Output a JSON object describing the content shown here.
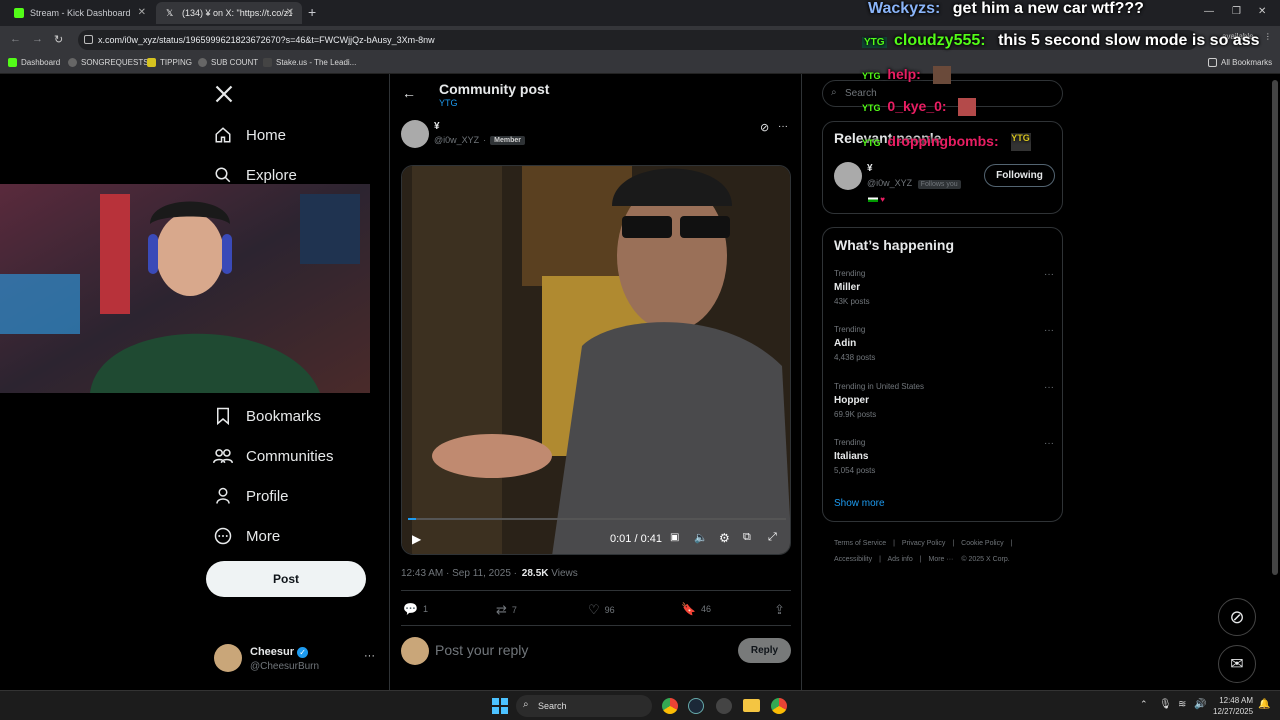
{
  "browser": {
    "tabs": [
      {
        "label": "Stream - Kick Dashboard",
        "favicon_color": "#53fc18"
      },
      {
        "label": "(134) ¥ on X: \"https://t.co/z1Ori",
        "favicon_color": "#ffffff"
      }
    ],
    "url": "x.com/i0w_xyz/status/1965999621823672670?s=46&t=FWCWjjQz-bAusy_3Xm-8nw",
    "bookmarks": [
      "Dashboard",
      "SONGREQUESTS",
      "TIPPING",
      "SUB COUNT",
      "Stake.us - The Leadi..."
    ],
    "all_bookmarks": "All Bookmarks",
    "update_badge": "available"
  },
  "nav": {
    "home": "Home",
    "explore": "Explore",
    "bookmarks": "Bookmarks",
    "communities": "Communities",
    "profile": "Profile",
    "more": "More",
    "post": "Post"
  },
  "account": {
    "name": "Cheesur",
    "handle": "@CheesurBurn",
    "more": "···"
  },
  "post_header": {
    "title": "Community post",
    "community": "YTG"
  },
  "post": {
    "author_name": "¥",
    "author_handle": "@i0w_XYZ",
    "separator": "·",
    "badge": "Member",
    "more": "···",
    "video_time": "0:01 / 0:41",
    "video_progress": 0.02,
    "timestamp": "12:43 AM · Sep 11, 2025 ·",
    "views_count": "28.5K",
    "views_label": "Views",
    "replies": "1",
    "reposts": "7",
    "likes": "96",
    "bookmarks": "46",
    "reply_placeholder": "Post your reply",
    "reply_button": "Reply"
  },
  "right": {
    "search_placeholder": "Search",
    "relevant_title": "Relevant people",
    "relevant_name": "¥",
    "relevant_handle": "@i0w_XYZ",
    "follows_you": "Follows you",
    "following_button": "Following",
    "happening_title": "What’s happening",
    "trends": [
      {
        "meta": "Trending",
        "name": "Miller",
        "count": "43K posts"
      },
      {
        "meta": "Trending",
        "name": "Adin",
        "count": "4,438 posts"
      },
      {
        "meta": "Trending in United States",
        "name": "Hopper",
        "count": "69.9K posts"
      },
      {
        "meta": "Trending",
        "name": "Italians",
        "count": "5,054 posts"
      }
    ],
    "show_more": "Show more",
    "footer": [
      "Terms of Service",
      "|",
      "Privacy Policy",
      "|",
      "Cookie Policy",
      "|",
      "Accessibility",
      "|",
      "Ads info",
      "|",
      "More ···",
      "© 2025 X Corp."
    ]
  },
  "chat": [
    {
      "nick": "Wackyzs:",
      "msg": "get him a new car wtf???",
      "color": "#8ab4f8"
    },
    {
      "nick": "cloudzy555:",
      "msg": "this 5 second slow mode is so ass",
      "color": "#53fc18"
    },
    {
      "nick": "help:",
      "msg": "",
      "color": "#e91e63"
    },
    {
      "nick": "0_kye_0:",
      "msg": "",
      "color": "#e91e63"
    },
    {
      "nick": "droppingbombs:",
      "msg": "",
      "color": "#e91e63"
    }
  ],
  "taskbar": {
    "search": "Search",
    "time": "12:48 AM",
    "date": "12/27/2025"
  },
  "colors": {
    "accent": "#1d9bf0",
    "kick_green": "#53fc18"
  }
}
